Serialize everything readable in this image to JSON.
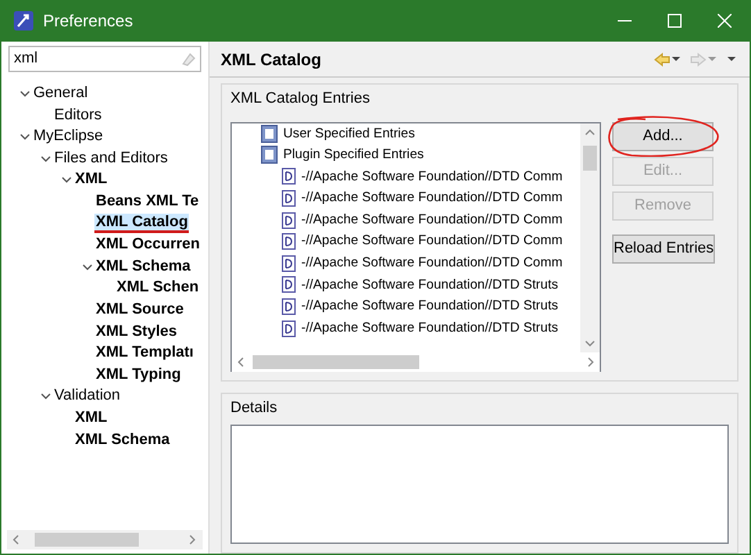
{
  "window": {
    "title": "Preferences"
  },
  "filter": {
    "value": "xml"
  },
  "tree": [
    {
      "label": "General",
      "matched": false,
      "selected": false,
      "expanded": true,
      "children": [
        {
          "label": "Editors",
          "matched": false,
          "selected": false
        }
      ]
    },
    {
      "label": "MyEclipse",
      "matched": false,
      "selected": false,
      "expanded": true,
      "children": [
        {
          "label": "Files and Editors",
          "matched": false,
          "selected": false,
          "expanded": true,
          "children": [
            {
              "label": "XML",
              "matched": true,
              "selected": false,
              "expanded": true,
              "children": [
                {
                  "label": "Beans XML Te",
                  "matched": true,
                  "selected": false
                },
                {
                  "label": "XML Catalog",
                  "matched": true,
                  "selected": true,
                  "underlined": true
                },
                {
                  "label": "XML Occurren",
                  "matched": true,
                  "selected": false
                },
                {
                  "label": "XML Schema",
                  "matched": true,
                  "selected": false,
                  "expanded": true,
                  "children": [
                    {
                      "label": "XML Schen",
                      "matched": true,
                      "selected": false
                    }
                  ]
                },
                {
                  "label": "XML Source",
                  "matched": true,
                  "selected": false
                },
                {
                  "label": "XML Styles",
                  "matched": true,
                  "selected": false
                },
                {
                  "label": "XML Templatı",
                  "matched": true,
                  "selected": false
                },
                {
                  "label": "XML Typing",
                  "matched": true,
                  "selected": false
                }
              ]
            }
          ]
        },
        {
          "label": "Validation",
          "matched": false,
          "selected": false,
          "expanded": true,
          "children": [
            {
              "label": "XML",
              "matched": true,
              "selected": false
            },
            {
              "label": "XML Schema",
              "matched": true,
              "selected": false
            }
          ]
        }
      ]
    }
  ],
  "page": {
    "title": "XML Catalog"
  },
  "entries_group": {
    "title": "XML Catalog Entries",
    "entries": [
      {
        "label": "User Specified Entries",
        "kind": "catalog"
      },
      {
        "label": "Plugin Specified Entries",
        "kind": "catalog",
        "children": [
          {
            "label": "-//Apache Software Foundation//DTD Comm",
            "kind": "dtd"
          },
          {
            "label": "-//Apache Software Foundation//DTD Comm",
            "kind": "dtd"
          },
          {
            "label": "-//Apache Software Foundation//DTD Comm",
            "kind": "dtd"
          },
          {
            "label": "-//Apache Software Foundation//DTD Comm",
            "kind": "dtd"
          },
          {
            "label": "-//Apache Software Foundation//DTD Comm",
            "kind": "dtd"
          },
          {
            "label": "-//Apache Software Foundation//DTD Struts",
            "kind": "dtd"
          },
          {
            "label": "-//Apache Software Foundation//DTD Struts",
            "kind": "dtd"
          },
          {
            "label": "-//Apache Software Foundation//DTD Struts",
            "kind": "dtd"
          }
        ]
      }
    ],
    "buttons": [
      {
        "label": "Add...",
        "disabled": false,
        "circled": true
      },
      {
        "label": "Edit...",
        "disabled": true,
        "circled": false
      },
      {
        "label": "Remove",
        "disabled": true,
        "circled": false
      },
      {
        "label": "Reload Entries",
        "disabled": false,
        "circled": false
      }
    ]
  },
  "details_group": {
    "title": "Details"
  }
}
